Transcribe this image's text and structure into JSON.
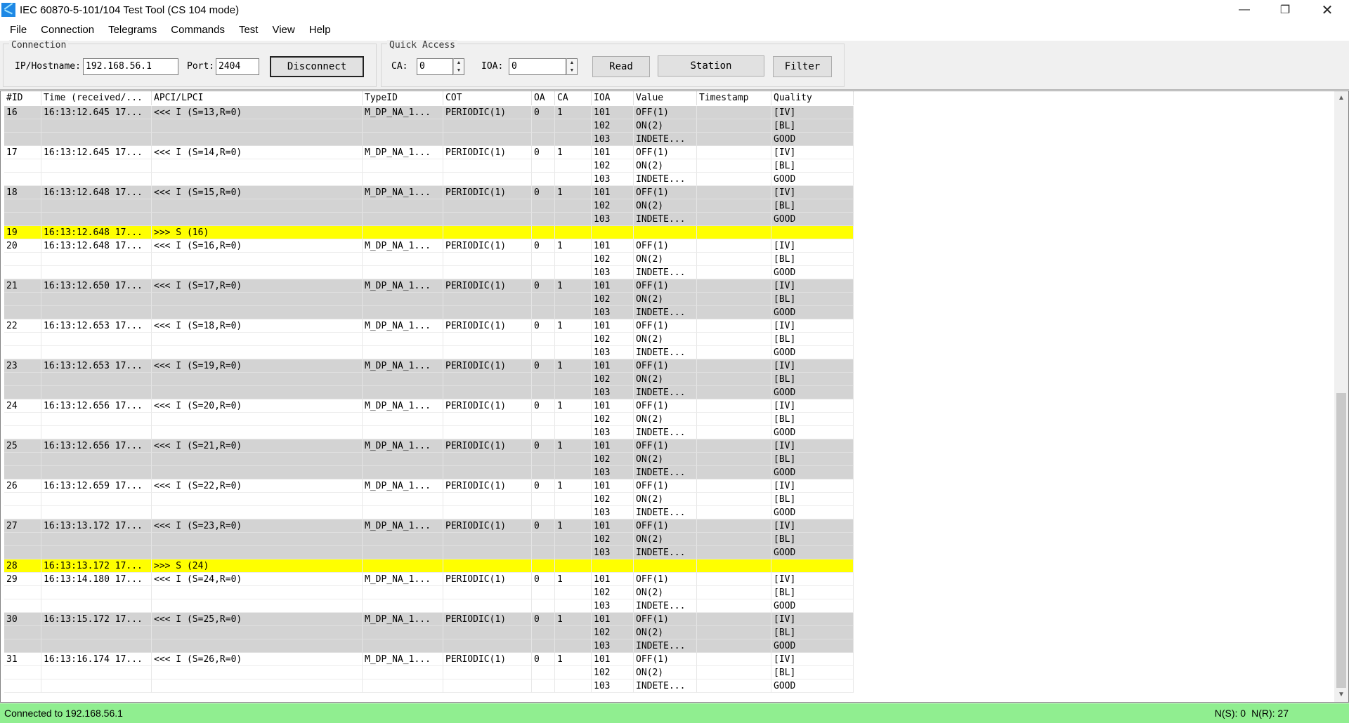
{
  "window": {
    "title": "IEC 60870-5-101/104 Test Tool (CS 104 mode)",
    "controls": {
      "minimize": "—",
      "restore": "❐",
      "close": "✕"
    }
  },
  "menu": [
    "File",
    "Connection",
    "Telegrams",
    "Commands",
    "Test",
    "View",
    "Help"
  ],
  "connection": {
    "group_label": "Connection",
    "ip_label": "IP/Hostname:",
    "ip_value": "192.168.56.1",
    "port_label": "Port:",
    "port_value": "2404",
    "disconnect_label": "Disconnect"
  },
  "quick_access": {
    "group_label": "Quick Access",
    "ca_label": "CA:",
    "ca_value": "0",
    "ioa_label": "IOA:",
    "ioa_value": "0",
    "read_label": "Read",
    "station_label": "Station",
    "filter_label": "Filter"
  },
  "grid": {
    "columns": [
      "#ID",
      "Time (received/...",
      "APCI/LPCI",
      "TypeID",
      "COT",
      "OA",
      "CA",
      "IOA",
      "Value",
      "Timestamp",
      "Quality"
    ],
    "rows": [
      [
        "16",
        "16:13:12.645 17...",
        "<<< I (S=13,R=0)",
        "M_DP_NA_1...",
        "PERIODIC(1)",
        "0",
        "1",
        "101",
        "OFF(1)",
        "",
        "[IV]",
        "shade"
      ],
      [
        "",
        "",
        "",
        "",
        "",
        "",
        "",
        "102",
        "ON(2)",
        "",
        "[BL]",
        "shade"
      ],
      [
        "",
        "",
        "",
        "",
        "",
        "",
        "",
        "103",
        "INDETE...",
        "",
        "GOOD",
        "shade"
      ],
      [
        "17",
        "16:13:12.645 17...",
        "<<< I (S=14,R=0)",
        "M_DP_NA_1...",
        "PERIODIC(1)",
        "0",
        "1",
        "101",
        "OFF(1)",
        "",
        "[IV]",
        ""
      ],
      [
        "",
        "",
        "",
        "",
        "",
        "",
        "",
        "102",
        "ON(2)",
        "",
        "[BL]",
        ""
      ],
      [
        "",
        "",
        "",
        "",
        "",
        "",
        "",
        "103",
        "INDETE...",
        "",
        "GOOD",
        ""
      ],
      [
        "18",
        "16:13:12.648 17...",
        "<<< I (S=15,R=0)",
        "M_DP_NA_1...",
        "PERIODIC(1)",
        "0",
        "1",
        "101",
        "OFF(1)",
        "",
        "[IV]",
        "shade"
      ],
      [
        "",
        "",
        "",
        "",
        "",
        "",
        "",
        "102",
        "ON(2)",
        "",
        "[BL]",
        "shade"
      ],
      [
        "",
        "",
        "",
        "",
        "",
        "",
        "",
        "103",
        "INDETE...",
        "",
        "GOOD",
        "shade"
      ],
      [
        "19",
        "16:13:12.648 17...",
        ">>> S (16)",
        "",
        "",
        "",
        "",
        "",
        "",
        "",
        "",
        "hl"
      ],
      [
        "20",
        "16:13:12.648 17...",
        "<<< I (S=16,R=0)",
        "M_DP_NA_1...",
        "PERIODIC(1)",
        "0",
        "1",
        "101",
        "OFF(1)",
        "",
        "[IV]",
        ""
      ],
      [
        "",
        "",
        "",
        "",
        "",
        "",
        "",
        "102",
        "ON(2)",
        "",
        "[BL]",
        ""
      ],
      [
        "",
        "",
        "",
        "",
        "",
        "",
        "",
        "103",
        "INDETE...",
        "",
        "GOOD",
        ""
      ],
      [
        "21",
        "16:13:12.650 17...",
        "<<< I (S=17,R=0)",
        "M_DP_NA_1...",
        "PERIODIC(1)",
        "0",
        "1",
        "101",
        "OFF(1)",
        "",
        "[IV]",
        "shade"
      ],
      [
        "",
        "",
        "",
        "",
        "",
        "",
        "",
        "102",
        "ON(2)",
        "",
        "[BL]",
        "shade"
      ],
      [
        "",
        "",
        "",
        "",
        "",
        "",
        "",
        "103",
        "INDETE...",
        "",
        "GOOD",
        "shade"
      ],
      [
        "22",
        "16:13:12.653 17...",
        "<<< I (S=18,R=0)",
        "M_DP_NA_1...",
        "PERIODIC(1)",
        "0",
        "1",
        "101",
        "OFF(1)",
        "",
        "[IV]",
        ""
      ],
      [
        "",
        "",
        "",
        "",
        "",
        "",
        "",
        "102",
        "ON(2)",
        "",
        "[BL]",
        ""
      ],
      [
        "",
        "",
        "",
        "",
        "",
        "",
        "",
        "103",
        "INDETE...",
        "",
        "GOOD",
        ""
      ],
      [
        "23",
        "16:13:12.653 17...",
        "<<< I (S=19,R=0)",
        "M_DP_NA_1...",
        "PERIODIC(1)",
        "0",
        "1",
        "101",
        "OFF(1)",
        "",
        "[IV]",
        "shade"
      ],
      [
        "",
        "",
        "",
        "",
        "",
        "",
        "",
        "102",
        "ON(2)",
        "",
        "[BL]",
        "shade"
      ],
      [
        "",
        "",
        "",
        "",
        "",
        "",
        "",
        "103",
        "INDETE...",
        "",
        "GOOD",
        "shade"
      ],
      [
        "24",
        "16:13:12.656 17...",
        "<<< I (S=20,R=0)",
        "M_DP_NA_1...",
        "PERIODIC(1)",
        "0",
        "1",
        "101",
        "OFF(1)",
        "",
        "[IV]",
        ""
      ],
      [
        "",
        "",
        "",
        "",
        "",
        "",
        "",
        "102",
        "ON(2)",
        "",
        "[BL]",
        ""
      ],
      [
        "",
        "",
        "",
        "",
        "",
        "",
        "",
        "103",
        "INDETE...",
        "",
        "GOOD",
        ""
      ],
      [
        "25",
        "16:13:12.656 17...",
        "<<< I (S=21,R=0)",
        "M_DP_NA_1...",
        "PERIODIC(1)",
        "0",
        "1",
        "101",
        "OFF(1)",
        "",
        "[IV]",
        "shade"
      ],
      [
        "",
        "",
        "",
        "",
        "",
        "",
        "",
        "102",
        "ON(2)",
        "",
        "[BL]",
        "shade"
      ],
      [
        "",
        "",
        "",
        "",
        "",
        "",
        "",
        "103",
        "INDETE...",
        "",
        "GOOD",
        "shade"
      ],
      [
        "26",
        "16:13:12.659 17...",
        "<<< I (S=22,R=0)",
        "M_DP_NA_1...",
        "PERIODIC(1)",
        "0",
        "1",
        "101",
        "OFF(1)",
        "",
        "[IV]",
        ""
      ],
      [
        "",
        "",
        "",
        "",
        "",
        "",
        "",
        "102",
        "ON(2)",
        "",
        "[BL]",
        ""
      ],
      [
        "",
        "",
        "",
        "",
        "",
        "",
        "",
        "103",
        "INDETE...",
        "",
        "GOOD",
        ""
      ],
      [
        "27",
        "16:13:13.172 17...",
        "<<< I (S=23,R=0)",
        "M_DP_NA_1...",
        "PERIODIC(1)",
        "0",
        "1",
        "101",
        "OFF(1)",
        "",
        "[IV]",
        "shade"
      ],
      [
        "",
        "",
        "",
        "",
        "",
        "",
        "",
        "102",
        "ON(2)",
        "",
        "[BL]",
        "shade"
      ],
      [
        "",
        "",
        "",
        "",
        "",
        "",
        "",
        "103",
        "INDETE...",
        "",
        "GOOD",
        "shade"
      ],
      [
        "28",
        "16:13:13.172 17...",
        ">>> S (24)",
        "",
        "",
        "",
        "",
        "",
        "",
        "",
        "",
        "hl"
      ],
      [
        "29",
        "16:13:14.180 17...",
        "<<< I (S=24,R=0)",
        "M_DP_NA_1...",
        "PERIODIC(1)",
        "0",
        "1",
        "101",
        "OFF(1)",
        "",
        "[IV]",
        ""
      ],
      [
        "",
        "",
        "",
        "",
        "",
        "",
        "",
        "102",
        "ON(2)",
        "",
        "[BL]",
        ""
      ],
      [
        "",
        "",
        "",
        "",
        "",
        "",
        "",
        "103",
        "INDETE...",
        "",
        "GOOD",
        ""
      ],
      [
        "30",
        "16:13:15.172 17...",
        "<<< I (S=25,R=0)",
        "M_DP_NA_1...",
        "PERIODIC(1)",
        "0",
        "1",
        "101",
        "OFF(1)",
        "",
        "[IV]",
        "shade"
      ],
      [
        "",
        "",
        "",
        "",
        "",
        "",
        "",
        "102",
        "ON(2)",
        "",
        "[BL]",
        "shade"
      ],
      [
        "",
        "",
        "",
        "",
        "",
        "",
        "",
        "103",
        "INDETE...",
        "",
        "GOOD",
        "shade"
      ],
      [
        "31",
        "16:13:16.174 17...",
        "<<< I (S=26,R=0)",
        "M_DP_NA_1...",
        "PERIODIC(1)",
        "0",
        "1",
        "101",
        "OFF(1)",
        "",
        "[IV]",
        ""
      ],
      [
        "",
        "",
        "",
        "",
        "",
        "",
        "",
        "102",
        "ON(2)",
        "",
        "[BL]",
        ""
      ],
      [
        "",
        "",
        "",
        "",
        "",
        "",
        "",
        "103",
        "INDETE...",
        "",
        "GOOD",
        ""
      ]
    ]
  },
  "scrollbar": {
    "up_arrow": "▲",
    "down_arrow": "▼"
  },
  "status": {
    "text": "Connected to 192.168.56.1",
    "ns": "N(S): 0",
    "nr": "N(R): 27",
    "color": "#90ee90"
  },
  "colors": {
    "row_shade": "#d3d3d3",
    "row_highlight": "#ffff00"
  }
}
